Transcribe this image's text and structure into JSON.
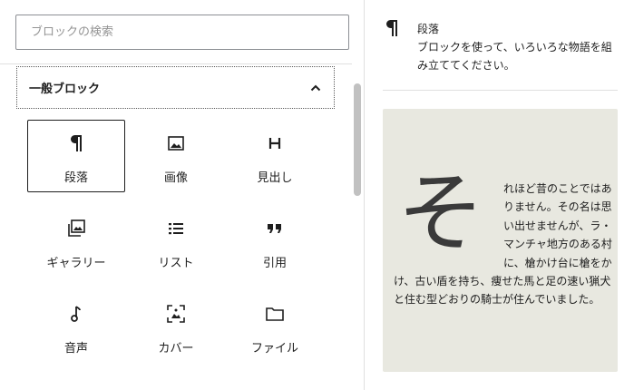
{
  "search": {
    "placeholder": "ブロックの検索"
  },
  "panel": {
    "title": "一般ブロック"
  },
  "blocks": [
    {
      "label": "段落",
      "icon": "paragraph-icon"
    },
    {
      "label": "画像",
      "icon": "image-icon"
    },
    {
      "label": "見出し",
      "icon": "heading-icon"
    },
    {
      "label": "ギャラリー",
      "icon": "gallery-icon"
    },
    {
      "label": "リスト",
      "icon": "list-icon"
    },
    {
      "label": "引用",
      "icon": "quote-icon"
    },
    {
      "label": "音声",
      "icon": "audio-icon"
    },
    {
      "label": "カバー",
      "icon": "cover-icon"
    },
    {
      "label": "ファイル",
      "icon": "file-icon"
    }
  ],
  "preview": {
    "title": "段落",
    "description": "ブロックを使って、いろいろな物語を組み立ててください。",
    "dropcap": "そ",
    "body": "れほど昔のことではありません。その名は思い出せませんが、ラ・マンチャ地方のある村に、槍かけ台に槍をかけ、古い盾を持ち、痩せた馬と足の速い猟犬と住む型どおりの騎士が住んでいました。"
  },
  "colors": {
    "preview_background": "#e8e8e0",
    "text": "#1e1e1e"
  }
}
